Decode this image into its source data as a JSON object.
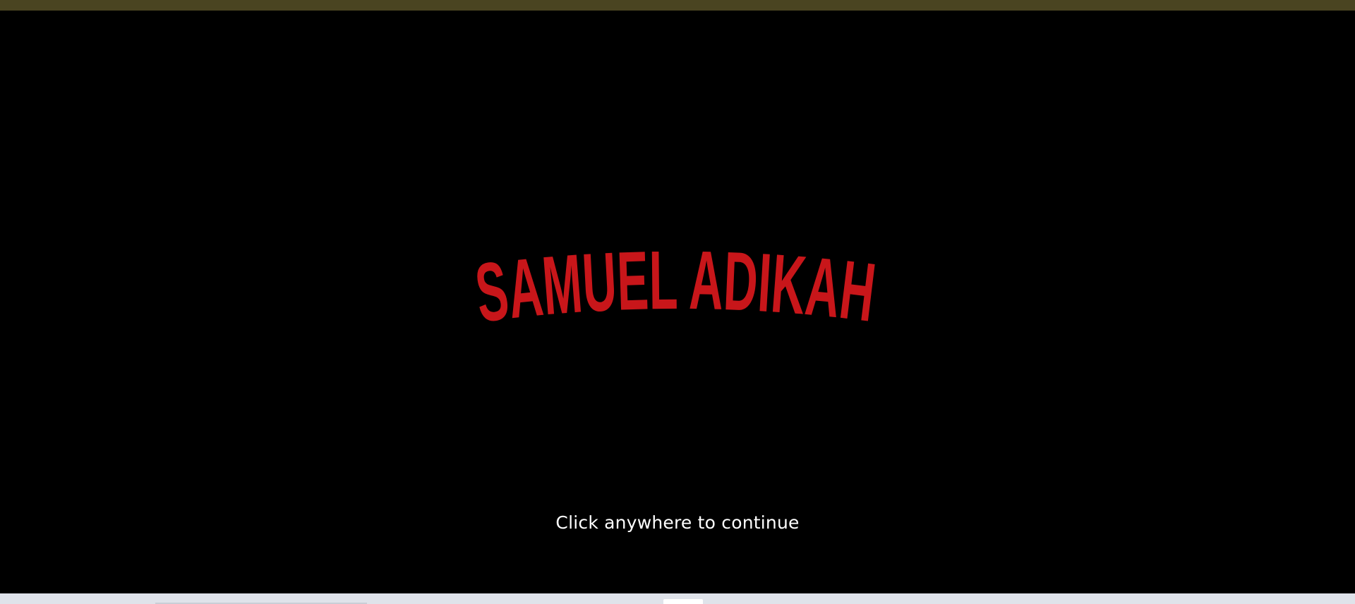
{
  "colors": {
    "background": "#000000",
    "top_strip": "#4a4421",
    "logo": "#c8161a",
    "hint_text": "#ffffff",
    "bottom_bar": "#dfe3ea"
  },
  "splash": {
    "logo_text": "SAMUEL ADIKAH",
    "hint": "Click anywhere to continue"
  }
}
